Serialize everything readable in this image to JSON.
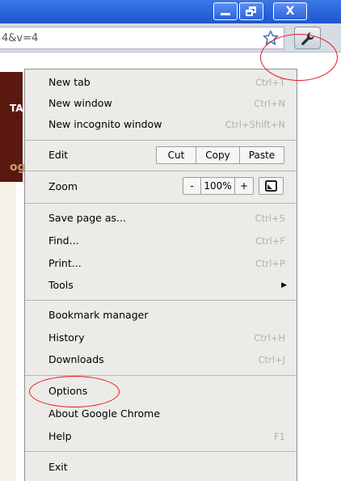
{
  "window": {
    "close_glyph": "X"
  },
  "address_bar": {
    "url_fragment": "4&v=4"
  },
  "page": {
    "fragment_top": "TA",
    "fragment_bottom": "og"
  },
  "icons": {
    "star": "star-outline",
    "wrench": "wrench",
    "fullscreen": "fullscreen-square"
  },
  "menu": {
    "group1": [
      {
        "label": "New tab",
        "shortcut": "Ctrl+T"
      },
      {
        "label": "New window",
        "shortcut": "Ctrl+N"
      },
      {
        "label": "New incognito window",
        "shortcut": "Ctrl+Shift+N"
      }
    ],
    "edit": {
      "label": "Edit",
      "cut": "Cut",
      "copy": "Copy",
      "paste": "Paste"
    },
    "zoom": {
      "label": "Zoom",
      "minus": "-",
      "level": "100%",
      "plus": "+"
    },
    "group3": [
      {
        "label": "Save page as...",
        "shortcut": "Ctrl+S"
      },
      {
        "label": "Find...",
        "shortcut": "Ctrl+F"
      },
      {
        "label": "Print...",
        "shortcut": "Ctrl+P"
      },
      {
        "label": "Tools",
        "shortcut": ""
      }
    ],
    "group4": [
      {
        "label": "Bookmark manager",
        "shortcut": ""
      },
      {
        "label": "History",
        "shortcut": "Ctrl+H"
      },
      {
        "label": "Downloads",
        "shortcut": "Ctrl+J"
      }
    ],
    "group5": [
      {
        "label": "Options",
        "shortcut": ""
      },
      {
        "label": "About Google Chrome",
        "shortcut": ""
      },
      {
        "label": "Help",
        "shortcut": "F1"
      }
    ],
    "exit": {
      "label": "Exit"
    }
  },
  "colors": {
    "annotation": "#e01a1a",
    "titlebar": "#2a64d8",
    "menu_bg": "#ecebe7"
  }
}
